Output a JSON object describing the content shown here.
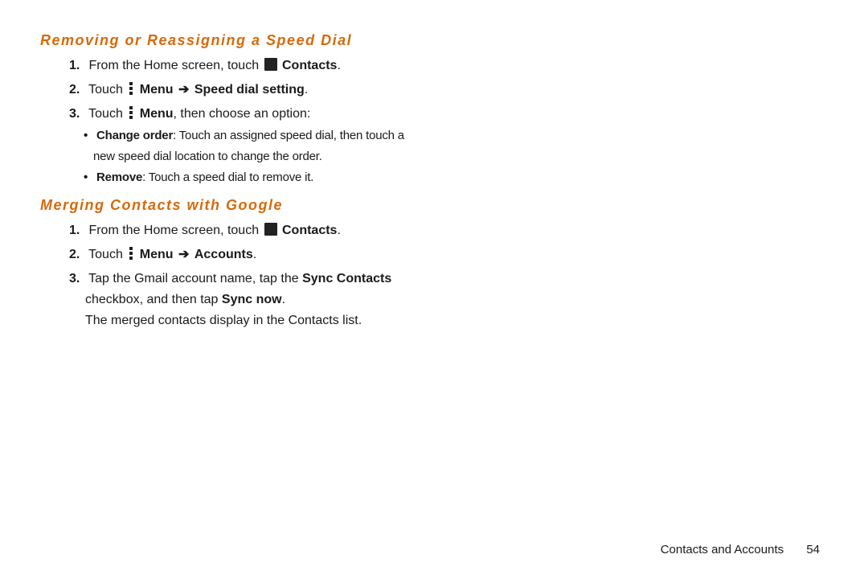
{
  "section1": {
    "title": "Removing or Reassigning a Speed Dial",
    "steps": {
      "s1": {
        "num": "1.",
        "pre": "From the Home screen, touch ",
        "app": "Contacts",
        "post": "."
      },
      "s2": {
        "num": "2.",
        "pre": "Touch ",
        "menu": "Menu",
        "arrow": "➔",
        "target": "Speed dial setting",
        "post": "."
      },
      "s3": {
        "num": "3.",
        "pre": "Touch ",
        "menu": "Menu",
        "post": ", then choose an option:",
        "bullets": {
          "b1": {
            "label": "Change order",
            "text1": ": Touch an assigned speed dial, then touch a",
            "text2": "new speed dial location to change the order."
          },
          "b2": {
            "label": "Remove",
            "text": ": Touch a speed dial to remove it."
          }
        }
      }
    }
  },
  "section2": {
    "title": "Merging Contacts with Google",
    "steps": {
      "s1": {
        "num": "1.",
        "pre": "From the Home screen, touch ",
        "app": "Contacts",
        "post": "."
      },
      "s2": {
        "num": "2.",
        "pre": "Touch ",
        "menu": "Menu",
        "arrow": "➔",
        "target": "Accounts",
        "post": "."
      },
      "s3": {
        "num": "3.",
        "line1_pre": "Tap the Gmail account name, tap the ",
        "line1_bold": "Sync Contacts",
        "line2_pre": "checkbox, and then tap ",
        "line2_bold": "Sync now",
        "line2_post": ".",
        "line3": "The merged contacts display in the Contacts list."
      }
    }
  },
  "footer": {
    "chapter": "Contacts and Accounts",
    "page": "54"
  }
}
